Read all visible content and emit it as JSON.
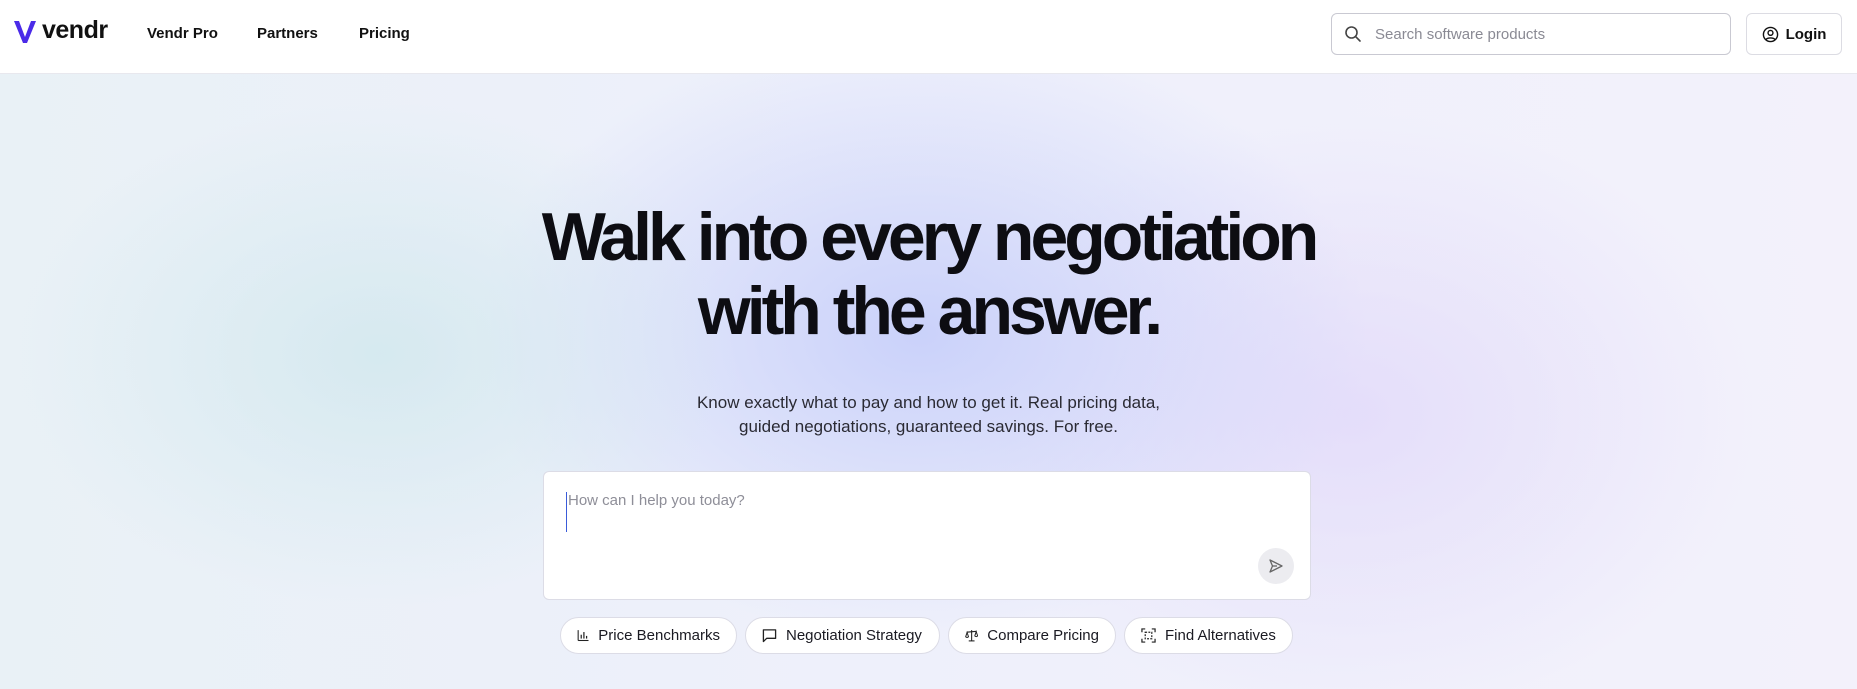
{
  "header": {
    "logo_text": "vendr",
    "nav": [
      "Vendr Pro",
      "Partners",
      "Pricing"
    ],
    "search_placeholder": "Search software products",
    "login_label": "Login"
  },
  "hero": {
    "headline_line1": "Walk into every negotiation",
    "headline_line2": "with the answer.",
    "subtext_line1": "Know exactly what to pay and how to get it. Real pricing data,",
    "subtext_line2": "guided negotiations, guaranteed savings. For free.",
    "prompt_placeholder": "How can I help you today?",
    "chips": [
      {
        "label": "Price Benchmarks",
        "icon": "bar-chart-icon"
      },
      {
        "label": "Negotiation Strategy",
        "icon": "message-icon"
      },
      {
        "label": "Compare Pricing",
        "icon": "scale-icon"
      },
      {
        "label": "Find Alternatives",
        "icon": "scan-icon"
      }
    ]
  },
  "colors": {
    "brand": "#4b2be8",
    "text": "#111111"
  }
}
